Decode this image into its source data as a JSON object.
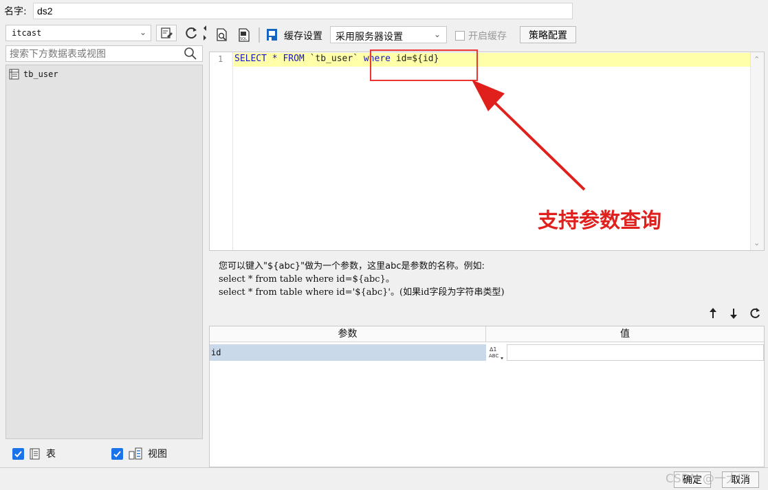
{
  "dataset": {
    "name_label": "名字:",
    "name_value": "ds2"
  },
  "left_panel": {
    "datasource": "itcast",
    "search_placeholder": "搜索下方数据表或视图",
    "items": [
      {
        "label": "tb_user",
        "icon": "table-icon"
      }
    ],
    "filters": [
      {
        "label": "表",
        "checked": true,
        "icon": "table-icon"
      },
      {
        "label": "视图",
        "checked": true,
        "icon": "view-icon"
      }
    ]
  },
  "toolbar": {
    "cache_label": "缓存设置",
    "cache_option": "采用服务器设置",
    "enable_cache_label": "开启缓存",
    "enable_cache_checked": false,
    "strategy_button": "策略配置"
  },
  "editor": {
    "line_number": "1",
    "tokens": {
      "select": "SELECT",
      "star": " * ",
      "from": "FROM",
      "table": " `tb_user` ",
      "where": "where",
      "cond": " id=${id}"
    }
  },
  "annotation": {
    "text": "支持参数查询",
    "color": "#e0201c"
  },
  "help": {
    "line1": "您可以键入\"${abc}\"做为一个参数，这里abc是参数的名称。例如:",
    "line2": "select * from table where id=${abc}。",
    "line3": "select * from table where id='${abc}'。(如果id字段为字符串类型)"
  },
  "params": {
    "headers": {
      "name": "参数",
      "value": "值"
    },
    "rows": [
      {
        "name": "id",
        "value": ""
      }
    ]
  },
  "footer": {
    "ok": "确定",
    "cancel": "取消",
    "watermark": "CSDN @一大IT"
  }
}
